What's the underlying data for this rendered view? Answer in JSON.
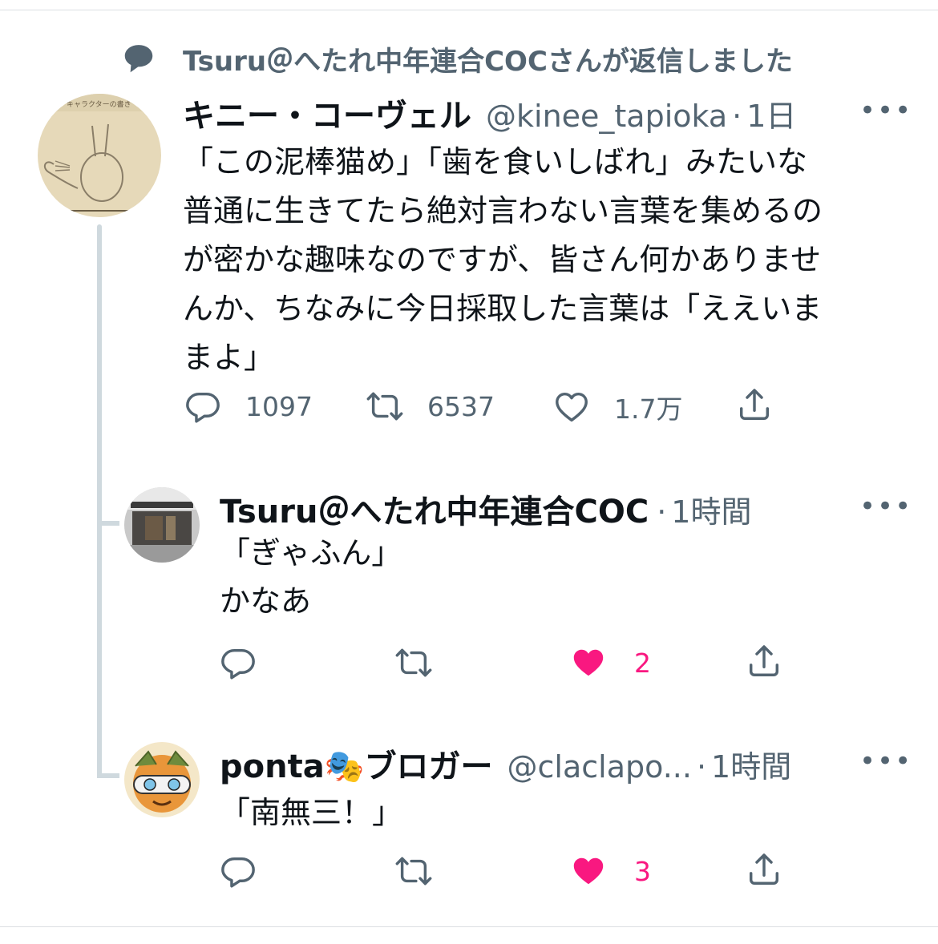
{
  "context": {
    "text": "Tsuru＠へたれ中年連合COCさんが返信しました"
  },
  "tweets": [
    {
      "name": "キニー・コーヴェル",
      "handle": "@kinee_tapioka",
      "dot": "·",
      "time": "1日",
      "text": "「この泥棒猫め」「歯を食いしばれ」みたいな\n普通に生きてたら絶対言わない言葉を集めるの\nが密かな趣味なのですが、皆さん何かありませ\nんか、ちなみに今日採取した言葉は「ええいま\nまよ」",
      "reply_count": "1097",
      "retweet_count": "6537",
      "like_count": "1.7万"
    },
    {
      "name": "Tsuru＠へたれ中年連合COC",
      "dot": "·",
      "time": "1時間",
      "text": "「ぎゃふん」\nかなあ",
      "like_count": "2",
      "liked": true
    },
    {
      "name": "ponta🎭ブロガー",
      "handle": "@claclapo...",
      "dot": "·",
      "time": "1時間",
      "text": "「南無三！」",
      "like_count": "3",
      "liked": true
    }
  ],
  "more_label": "•••",
  "colors": {
    "like": "#f91880",
    "muted": "#536471",
    "text": "#0f1419",
    "thread": "#cfd9de"
  },
  "icons": [
    "reply-icon",
    "retweet-icon",
    "like-icon",
    "share-icon",
    "speech-bubble-icon",
    "more-icon"
  ]
}
